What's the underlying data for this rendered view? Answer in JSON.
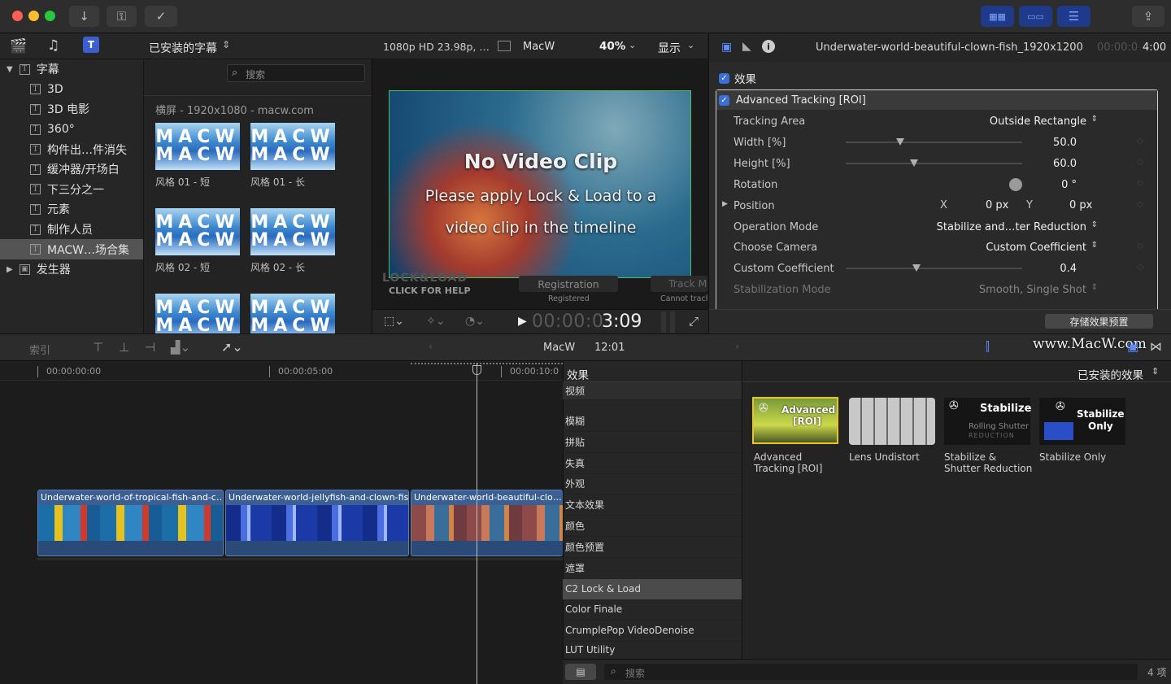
{
  "titlebar": {
    "buttons": [
      "import-icon",
      "keywords-icon",
      "background-tasks-icon"
    ],
    "right_buttons": [
      "browser-toggle-icon",
      "timeline-toggle-icon",
      "inspector-toggle-icon",
      "share-icon"
    ]
  },
  "browser": {
    "filter_label": "已安装的字幕",
    "search_placeholder": "搜索",
    "sidebar": {
      "root": "字幕",
      "items": [
        "3D",
        "3D 电影",
        "360°",
        "构件出…件消失",
        "缓冲器/开场白",
        "下三分之一",
        "元素",
        "制作人员",
        "MACW…场合集"
      ],
      "selected_index": 8,
      "generators": "发生器"
    },
    "group_header": "横屏 - 1920x1080 - macw.com",
    "thumbs": [
      {
        "label": "风格 01 - 短",
        "text_top": "MACW",
        "text_bottom": "MACW"
      },
      {
        "label": "风格 01 - 长",
        "text_top": "MACW",
        "text_bottom": "MACW"
      },
      {
        "label": "风格 02 - 短",
        "text_top": "MACW",
        "text_bottom": "MACW"
      },
      {
        "label": "风格 02 - 长",
        "text_top": "MACW",
        "text_bottom": "MACW"
      },
      {
        "label": "",
        "text_top": "MACW",
        "text_bottom": "MACW"
      },
      {
        "label": "",
        "text_top": "MACW",
        "text_bottom": "MACW"
      }
    ]
  },
  "viewer": {
    "format": "1080p HD 23.98p, …",
    "project": "MacW",
    "zoom": "40%",
    "display": "显示",
    "overlay_title": "No Video Clip",
    "overlay_line1": "Please apply Lock & Load to a",
    "overlay_line2": "video clip in the timeline",
    "logo": "LOCK&LOAD",
    "help": "CLICK FOR HELP",
    "registration_button": "Registration",
    "registered": "Registered",
    "track_button": "Track M",
    "cannot_track": "Cannot track",
    "timecode_dim": "00:00:0",
    "timecode": "3:09"
  },
  "inspector": {
    "clip_name": "Underwater-world-beautiful-clown-fish_1920x1200",
    "duration_dim": "00:00:0",
    "duration": "4:00",
    "section": "效果",
    "effect_name": "Advanced Tracking [ROI]",
    "params": [
      {
        "label": "Tracking Area",
        "value": "Outside Rectangle",
        "popup": true
      },
      {
        "label": "Width [%]",
        "value": "50.0",
        "slider": 0.3
      },
      {
        "label": "Height [%]",
        "value": "60.0",
        "slider": 0.38
      },
      {
        "label": "Rotation",
        "value": "0 °"
      },
      {
        "label": "Position",
        "x_label": "X",
        "x_value": "0 px",
        "y_label": "Y",
        "y_value": "0 px"
      },
      {
        "label": "Operation Mode",
        "value": "Stabilize and…ter Reduction",
        "popup": true
      },
      {
        "label": "Choose Camera",
        "value": "Custom Coefficient",
        "popup": true
      },
      {
        "label": "Custom Coefficient",
        "value": "0.4",
        "slider": 0.4
      },
      {
        "label": "Stabilization Mode",
        "value": "Smooth, Single Shot",
        "popup": true
      }
    ],
    "save_preset": "存储效果预置"
  },
  "timeline_bar": {
    "index": "索引",
    "project": "MacW",
    "duration": "12:01",
    "watermark": "www.MacW.com"
  },
  "timeline": {
    "ruler": [
      "00:00:00:00",
      "00:00:05:00",
      "00:00:10:0"
    ],
    "clips": [
      {
        "title": "Underwater-world-of-tropical-fish-and-c…"
      },
      {
        "title": "Underwater-world-jellyfish-and-clown-fis…"
      },
      {
        "title": "Underwater-world-beautiful-clo…"
      }
    ]
  },
  "effects": {
    "header": "效果",
    "installed": "已安装的效果",
    "categories": [
      "视频",
      "模糊",
      "拼贴",
      "失真",
      "外观",
      "文本效果",
      "颜色",
      "颜色预置",
      "遮罩",
      "C2 Lock & Load",
      "Color Finale",
      "CrumplePop VideoDenoise",
      "LUT Utility"
    ],
    "selected_category": 9,
    "tiles": [
      {
        "label_1": "Advanced",
        "label_2": "Tracking [ROI]",
        "thumb_text_1": "Advanced",
        "thumb_text_2": "[ROI]"
      },
      {
        "label_1": "Lens Undistort",
        "label_2": ""
      },
      {
        "label_1": "Stabilize &",
        "label_2": "Shutter Reduction",
        "thumb_text_1": "Stabilize",
        "thumb_text_2": "Rolling Shutter",
        "thumb_text_3": "REDUCTION"
      },
      {
        "label_1": "Stabilize Only",
        "label_2": "",
        "thumb_text_1": "Stabilize",
        "thumb_text_2": "Only"
      }
    ],
    "search_placeholder": "搜索",
    "count": "4 项"
  }
}
